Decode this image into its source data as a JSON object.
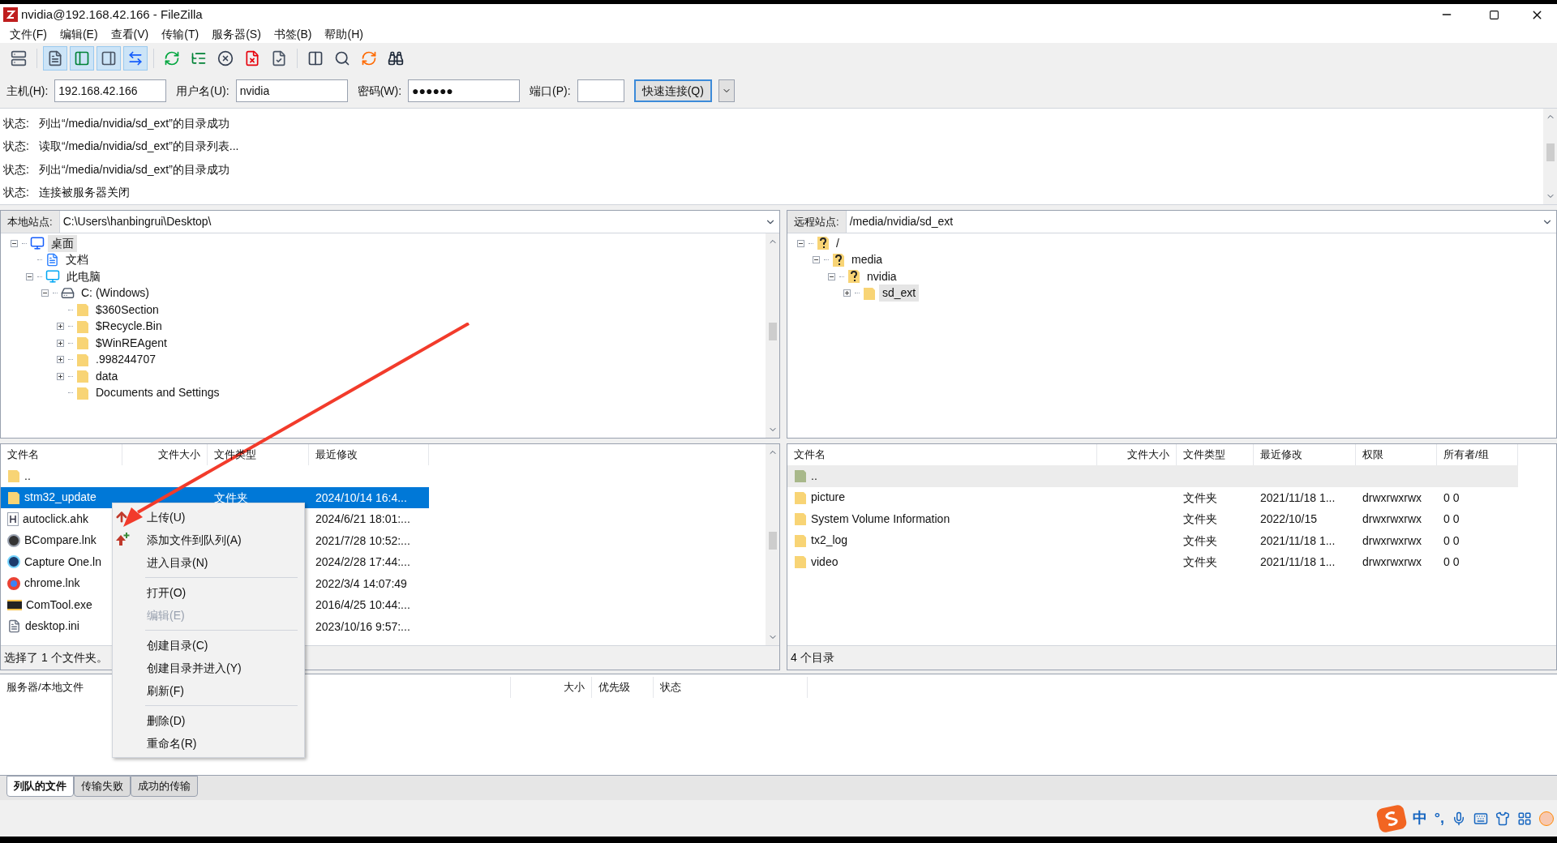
{
  "window": {
    "title": "nvidia@192.168.42.166 - FileZilla"
  },
  "menu": [
    "文件(F)",
    "编辑(E)",
    "查看(V)",
    "传输(T)",
    "服务器(S)",
    "书签(B)",
    "帮助(H)"
  ],
  "toolbar": [
    {
      "pressed": false
    },
    {
      "pressed": true
    },
    {
      "pressed": true
    },
    {
      "pressed": true
    },
    {
      "pressed": true
    },
    {
      "pressed": false
    },
    {
      "pressed": false
    },
    {
      "pressed": false
    },
    {
      "pressed": false
    },
    {
      "pressed": false
    },
    {
      "pressed": false
    },
    {
      "pressed": false
    },
    {
      "pressed": false
    },
    {
      "pressed": false
    }
  ],
  "quickconnect": {
    "host": {
      "label": "主机(H):",
      "value": "192.168.42.166"
    },
    "user": {
      "label": "用户名(U):",
      "value": "nvidia"
    },
    "password": {
      "label": "密码(W):",
      "value": "●●●●●●"
    },
    "port": {
      "label": "端口(P):"
    },
    "button": "快速连接(Q)"
  },
  "log": [
    {
      "label": "状态:",
      "message": "列出“/media/nvidia/sd_ext”的目录成功"
    },
    {
      "label": "状态:",
      "message": "读取“/media/nvidia/sd_ext”的目录列表..."
    },
    {
      "label": "状态:",
      "message": "列出“/media/nvidia/sd_ext”的目录成功"
    },
    {
      "label": "状态:",
      "message": "连接被服务器关闭"
    }
  ],
  "local": {
    "site_label": "本地站点:",
    "path": "C:\\Users\\hanbingrui\\Desktop\\",
    "tree": [
      {
        "label": "桌面",
        "kind": "desktop",
        "expanded": true,
        "selected": true,
        "children": [
          {
            "label": "文档",
            "kind": "document",
            "selected": false
          },
          {
            "label": "此电脑",
            "kind": "computer",
            "expanded": true,
            "selected": false,
            "children": [
              {
                "label": "C: (Windows)",
                "kind": "drive",
                "expanded": true,
                "selected": false,
                "children": [
                  {
                    "label": "$360Section",
                    "kind": "folder",
                    "selected": false
                  },
                  {
                    "label": "$Recycle.Bin",
                    "kind": "folder",
                    "expanded": false,
                    "selected": false
                  },
                  {
                    "label": "$WinREAgent",
                    "kind": "folder",
                    "expanded": false,
                    "selected": false
                  },
                  {
                    "label": ".998244707",
                    "kind": "folder",
                    "expanded": false,
                    "selected": false
                  },
                  {
                    "label": "data",
                    "kind": "folder",
                    "expanded": false,
                    "selected": false
                  },
                  {
                    "label": "Documents and Settings",
                    "kind": "folder",
                    "selected": false
                  }
                ]
              }
            ]
          }
        ]
      }
    ],
    "columns": [
      "文件名",
      "文件大小",
      "文件类型",
      "最近修改"
    ],
    "rows": [
      {
        "name": "..",
        "kind": "parent",
        "selected": false
      },
      {
        "name": "stm32_update",
        "kind": "folder",
        "type": "文件夹",
        "modified": "2024/10/14 16:4...",
        "selected": true
      },
      {
        "name": "autoclick.ahk",
        "kind": "script",
        "modified": "2024/6/21 18:01:...",
        "selected": false
      },
      {
        "name": "BCompare.lnk",
        "kind": "compare",
        "modified": "2021/7/28 10:52:...",
        "selected": false
      },
      {
        "name": "Capture One.ln",
        "kind": "capture",
        "modified": "2024/2/28 17:44:...",
        "selected": false
      },
      {
        "name": "chrome.lnk",
        "kind": "browser",
        "modified": "2022/3/4 14:07:49",
        "selected": false
      },
      {
        "name": "ComTool.exe",
        "kind": "exe",
        "modified": "2016/4/25 10:44:...",
        "selected": false
      },
      {
        "name": "desktop.ini",
        "kind": "ini",
        "modified": "2023/10/16 9:57:...",
        "selected": false
      }
    ],
    "status": "选择了 1 个文件夹。"
  },
  "remote": {
    "site_label": "远程站点:",
    "path": "/media/nvidia/sd_ext",
    "tree": [
      {
        "label": "/",
        "kind": "unknown",
        "expanded": true,
        "selected": false,
        "children": [
          {
            "label": "media",
            "kind": "unknown",
            "expanded": true,
            "selected": false,
            "children": [
              {
                "label": "nvidia",
                "kind": "unknown",
                "expanded": true,
                "selected": false,
                "children": [
                  {
                    "label": "sd_ext",
                    "kind": "folder",
                    "expanded": false,
                    "selected": true
                  }
                ]
              }
            ]
          }
        ]
      }
    ],
    "columns": [
      "文件名",
      "文件大小",
      "文件类型",
      "最近修改",
      "权限",
      "所有者/组"
    ],
    "rows": [
      {
        "name": "..",
        "kind": "parent",
        "focused": true
      },
      {
        "name": "picture",
        "kind": "folder",
        "type": "文件夹",
        "modified": "2021/11/18 1...",
        "permissions": "drwxrwxrwx",
        "owner": "0 0",
        "focused": false
      },
      {
        "name": "System Volume Information",
        "kind": "folder",
        "type": "文件夹",
        "modified": "2022/10/15",
        "permissions": "drwxrwxrwx",
        "owner": "0 0",
        "focused": false
      },
      {
        "name": "tx2_log",
        "kind": "folder",
        "type": "文件夹",
        "modified": "2021/11/18 1...",
        "permissions": "drwxrwxrwx",
        "owner": "0 0",
        "focused": false
      },
      {
        "name": "video",
        "kind": "folder",
        "type": "文件夹",
        "modified": "2021/11/18 1...",
        "permissions": "drwxrwxrwx",
        "owner": "0 0",
        "focused": false
      }
    ],
    "status": "4 个目录"
  },
  "context_menu": [
    {
      "kind": "upload",
      "label": "上传(U)",
      "disabled": false
    },
    {
      "kind": "enqueue",
      "label": "添加文件到队列(A)",
      "disabled": false
    },
    {
      "kind": "item",
      "label": "进入目录(N)",
      "disabled": false
    },
    {
      "kind": "separator"
    },
    {
      "kind": "item",
      "label": "打开(O)",
      "disabled": false
    },
    {
      "kind": "item",
      "label": "编辑(E)",
      "disabled": true
    },
    {
      "kind": "separator"
    },
    {
      "kind": "item",
      "label": "创建目录(C)",
      "disabled": false
    },
    {
      "kind": "item",
      "label": "创建目录并进入(Y)",
      "disabled": false
    },
    {
      "kind": "item",
      "label": "刷新(F)",
      "disabled": false
    },
    {
      "kind": "separator"
    },
    {
      "kind": "item",
      "label": "删除(D)",
      "disabled": false
    },
    {
      "kind": "item",
      "label": "重命名(R)",
      "disabled": false
    }
  ],
  "queue": {
    "columns": [
      "服务器/本地文件",
      "大小",
      "优先级",
      "状态"
    ]
  },
  "tabs": [
    {
      "label": "列队的文件",
      "selected": true
    },
    {
      "label": "传输失败",
      "selected": false
    },
    {
      "label": "成功的传输",
      "selected": false
    }
  ],
  "ime": [
    "中",
    "°,"
  ]
}
